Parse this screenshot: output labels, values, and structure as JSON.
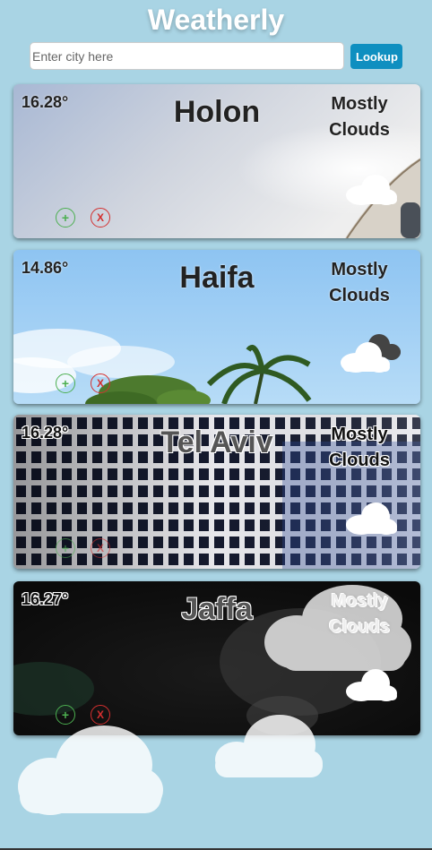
{
  "app": {
    "title": "Weatherly"
  },
  "search": {
    "placeholder": "Enter city here",
    "value": "",
    "button_label": "Lookup"
  },
  "cards": [
    {
      "temp": "16.28°",
      "city": "Holon",
      "desc_line1": "Mostly",
      "desc_line2": "Clouds",
      "add_label": "+",
      "remove_label": "X"
    },
    {
      "temp": "14.86°",
      "city": "Haifa",
      "desc_line1": "Mostly",
      "desc_line2": "Clouds",
      "add_label": "+",
      "remove_label": "X"
    },
    {
      "temp": "16.28°",
      "city": "Tel Aviv",
      "desc_line1": "Mostly",
      "desc_line2": "Clouds",
      "add_label": "+",
      "remove_label": "X"
    },
    {
      "temp": "16.27°",
      "city": "Jaffa",
      "desc_line1": "Mostly",
      "desc_line2": "Clouds",
      "add_label": "+",
      "remove_label": "X"
    }
  ],
  "icons": {
    "weather": "cloud-icon",
    "add": "plus-icon",
    "remove": "x-icon"
  },
  "colors": {
    "background": "#a9d4e4",
    "lookup_button": "#0f8fc0",
    "add": "#4caf50",
    "remove": "#d32f2f"
  }
}
